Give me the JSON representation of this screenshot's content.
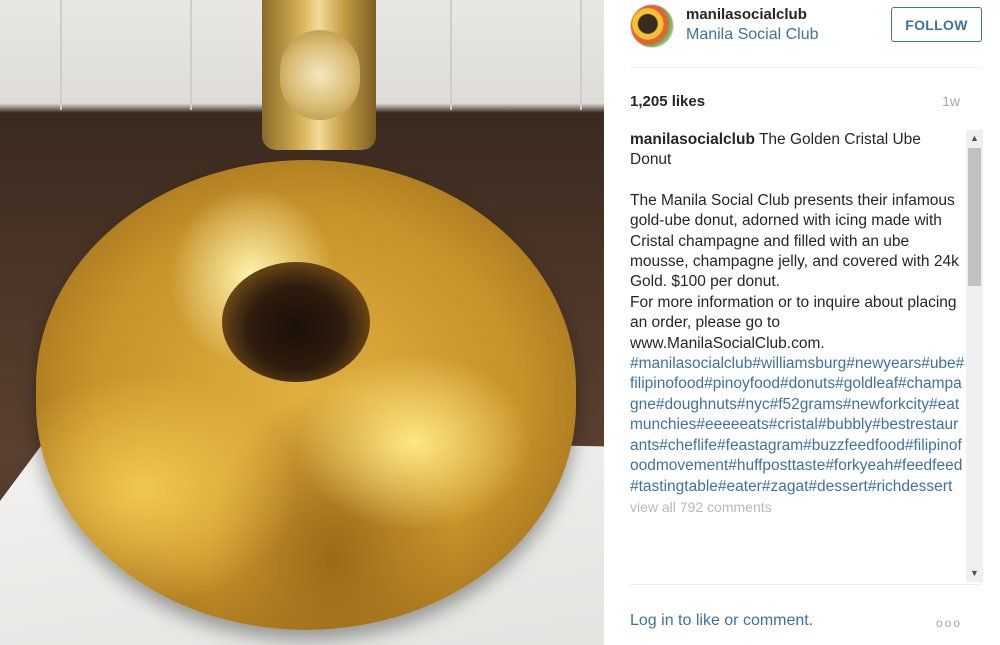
{
  "post": {
    "username": "manilasocialclub",
    "full_name": "Manila Social Club",
    "follow_label": "FOLLOW",
    "likes": "1,205 likes",
    "time_ago": "1w",
    "caption": {
      "username": "manilasocialclub",
      "title": "The Golden Cristal Ube Donut",
      "body": "The Manila Social Club presents their infamous gold-ube donut, adorned with icing made with Cristal champagne and filled with an ube mousse, champagne jelly, and covered with 24k Gold. $100 per donut.",
      "info": "For more information or to inquire about placing an order, please go to www.ManilaSocialClub.com.",
      "hashtags": "#manilasocialclub#williamsburg#newyears#ube#filipinofood#pinoyfood#donuts#goldleaf#champagne#doughnuts#nyc#f52grams#newforkcity#eatmunchies#eeeeeats#cristal#bubbly#bestrestaurants#cheflife#feastagram#buzzfeedfood#filipinofoodmovement#huffposttaste#forkyeah#feedfeed#tastingtable#eater#zagat#dessert#richdessert"
    },
    "view_all_comments": "view all 792 comments",
    "login_prompt": "Log in to like or comment.",
    "more_icon_glyph": "ooo"
  },
  "scrollbar": {
    "up_glyph": "▲",
    "down_glyph": "▼"
  },
  "colors": {
    "link_blue": "#3f729b",
    "muted_gray": "#a5a7aa",
    "text": "#262626"
  }
}
